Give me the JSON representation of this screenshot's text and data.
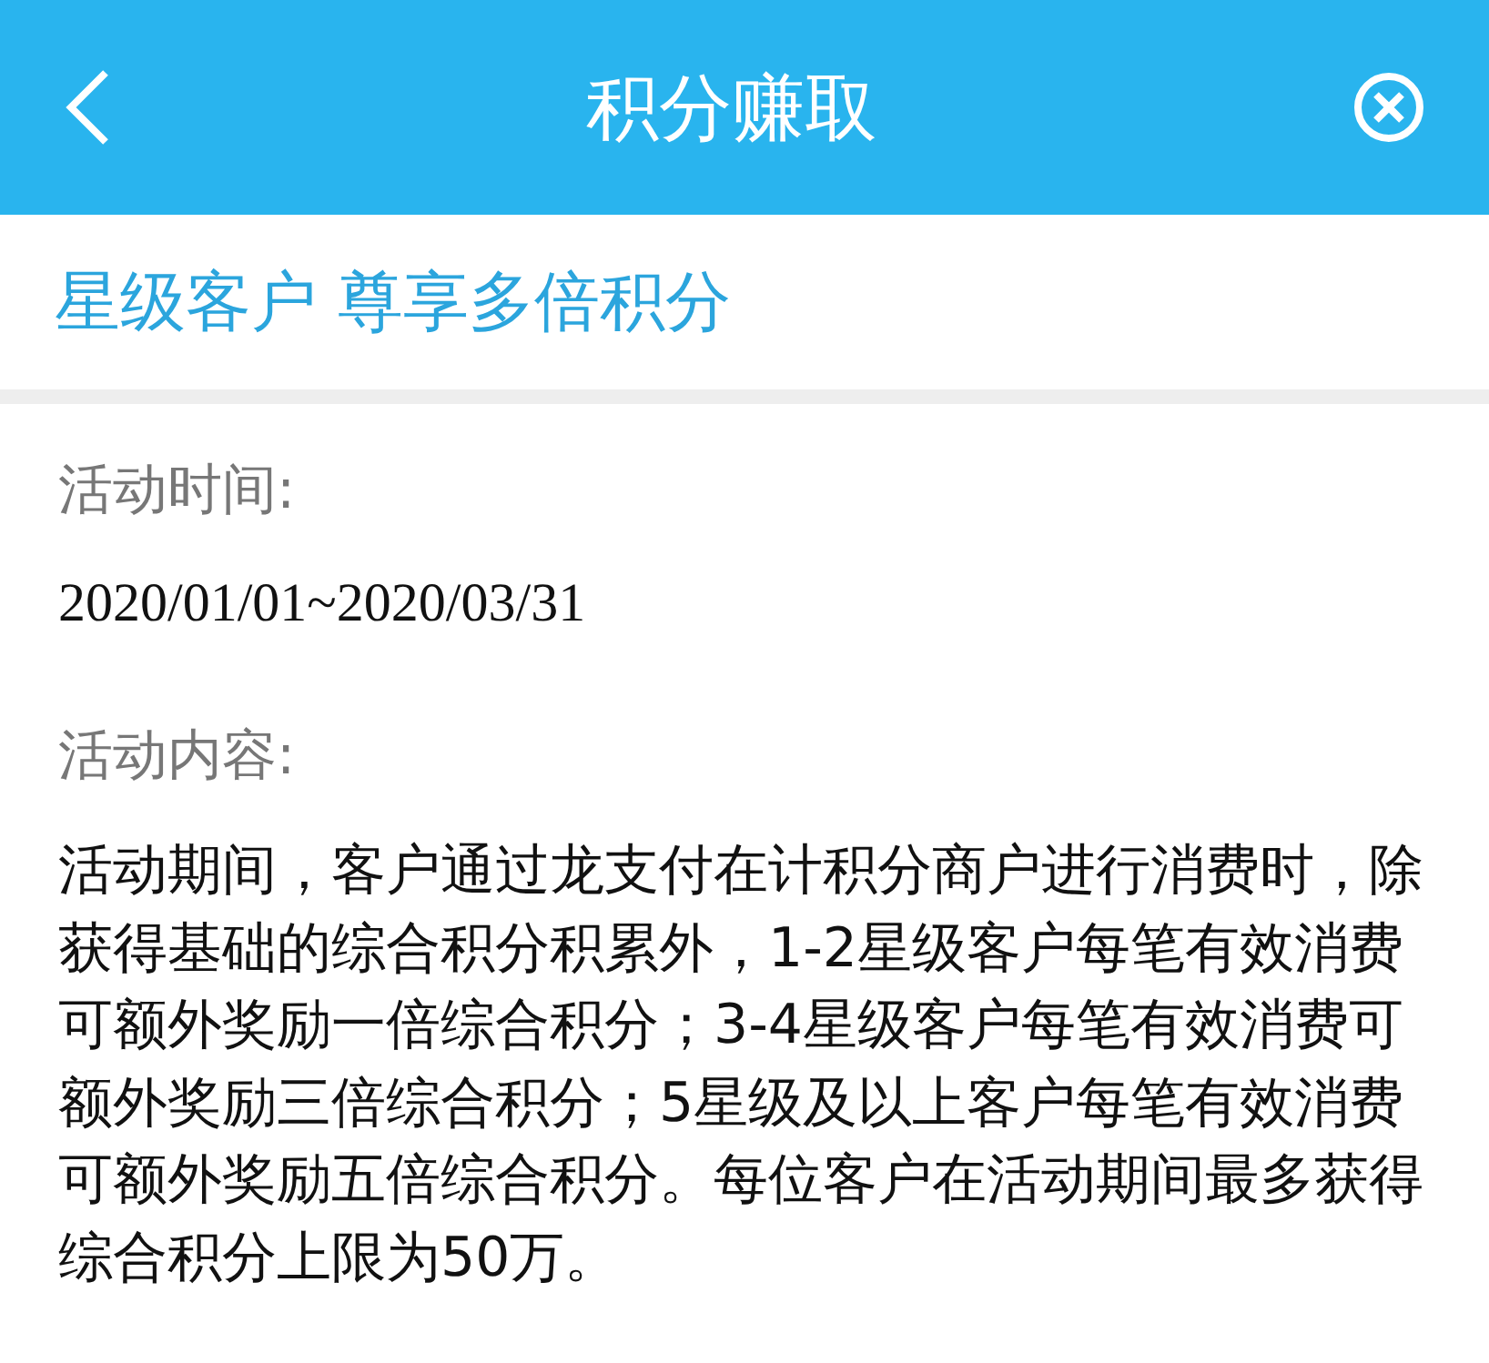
{
  "header": {
    "title": "积分赚取"
  },
  "banner": {
    "title": "星级客户 尊享多倍积分"
  },
  "sections": [
    {
      "label": "活动时间:",
      "text": "2020/01/01~2020/03/31",
      "kind": "date"
    },
    {
      "label": "活动内容:",
      "text": "活动期间，客户通过龙支付在计积分商户进行消费时，除获得基础的综合积分积累外，1-2星级客户每笔有效消费可额外奖励一倍综合积分；3-4星级客户每笔有效消费可额外奖励三倍综合积分；5星级及以上客户每笔有效消费可额外奖励五倍综合积分。每位客户在活动期间最多获得综合积分上限为50万。",
      "kind": "paragraph"
    }
  ]
}
